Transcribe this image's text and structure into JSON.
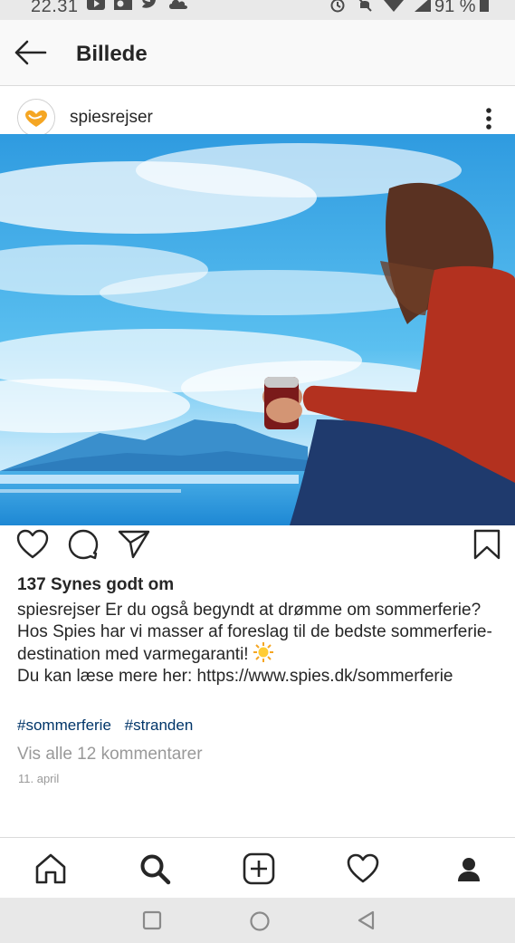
{
  "status_bar": {
    "time": "22.31",
    "battery": "91 %"
  },
  "header": {
    "title": "Billede",
    "back_icon": "arrow-left-icon"
  },
  "post": {
    "username": "spiesrejser",
    "more_icon": "more-vertical-icon",
    "likes": "137 Synes godt om",
    "caption": {
      "username": "spiesrejser",
      "line1": "Er du også begyndt at drømme om sommerferie?",
      "line2": "Hos Spies har vi masser af foreslag til de bedste sommerferie-",
      "line3": "destination med varmegaranti!",
      "line4": "Du kan læse mere her: https://www.spies.dk/sommerferie"
    },
    "hashtags": [
      "#sommerferie",
      "#stranden"
    ],
    "view_comments": "Vis alle 12 kommentarer",
    "date": "11. april"
  },
  "nav": {
    "items": [
      "home-icon",
      "search-icon",
      "add-post-icon",
      "heart-icon",
      "profile-icon"
    ]
  },
  "colors": {
    "link": "#003569",
    "muted": "#999999",
    "text": "#262626",
    "avatar_heart": "#f5a623"
  }
}
